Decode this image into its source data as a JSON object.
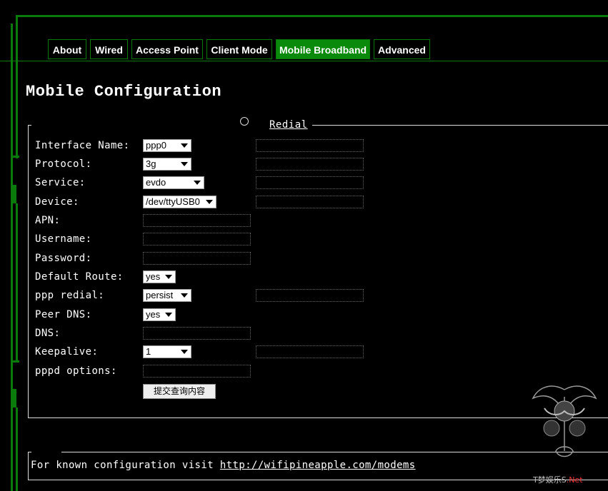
{
  "tabs": [
    {
      "label": "About",
      "active": false
    },
    {
      "label": "Wired",
      "active": false
    },
    {
      "label": "Access Point",
      "active": false
    },
    {
      "label": "Client Mode",
      "active": false
    },
    {
      "label": "Mobile Broadband",
      "active": true
    },
    {
      "label": "Advanced",
      "active": false
    }
  ],
  "page": {
    "title": "Mobile Configuration"
  },
  "form": {
    "legend": "Redial",
    "interface_name": {
      "label": "Interface Name:",
      "value": "ppp0"
    },
    "protocol": {
      "label": "Protocol:",
      "value": "3g"
    },
    "service": {
      "label": "Service:",
      "value": "evdo"
    },
    "device": {
      "label": "Device:",
      "value": "/dev/ttyUSB0"
    },
    "apn": {
      "label": "APN:",
      "value": ""
    },
    "username": {
      "label": "Username:",
      "value": ""
    },
    "password": {
      "label": "Password:",
      "value": ""
    },
    "default_route": {
      "label": "Default Route:",
      "value": "yes"
    },
    "ppp_redial": {
      "label": "ppp redial:",
      "value": "persist"
    },
    "peer_dns": {
      "label": "Peer DNS:",
      "value": "yes"
    },
    "dns": {
      "label": "DNS:",
      "value": ""
    },
    "keepalive": {
      "label": "Keepalive:",
      "value": "1"
    },
    "pppd_options": {
      "label": "pppd options:",
      "value": ""
    },
    "submit_label": "提交查询内容"
  },
  "footer": {
    "text": "For known configuration visit ",
    "link": "http://wifipineapple.com/modems"
  },
  "watermark": {
    "text": "T梦娱乐S",
    "suffix": ".Net"
  },
  "colors": {
    "accent": "#0a8a0a",
    "frame": "#0a7a0a",
    "background": "#000000"
  }
}
